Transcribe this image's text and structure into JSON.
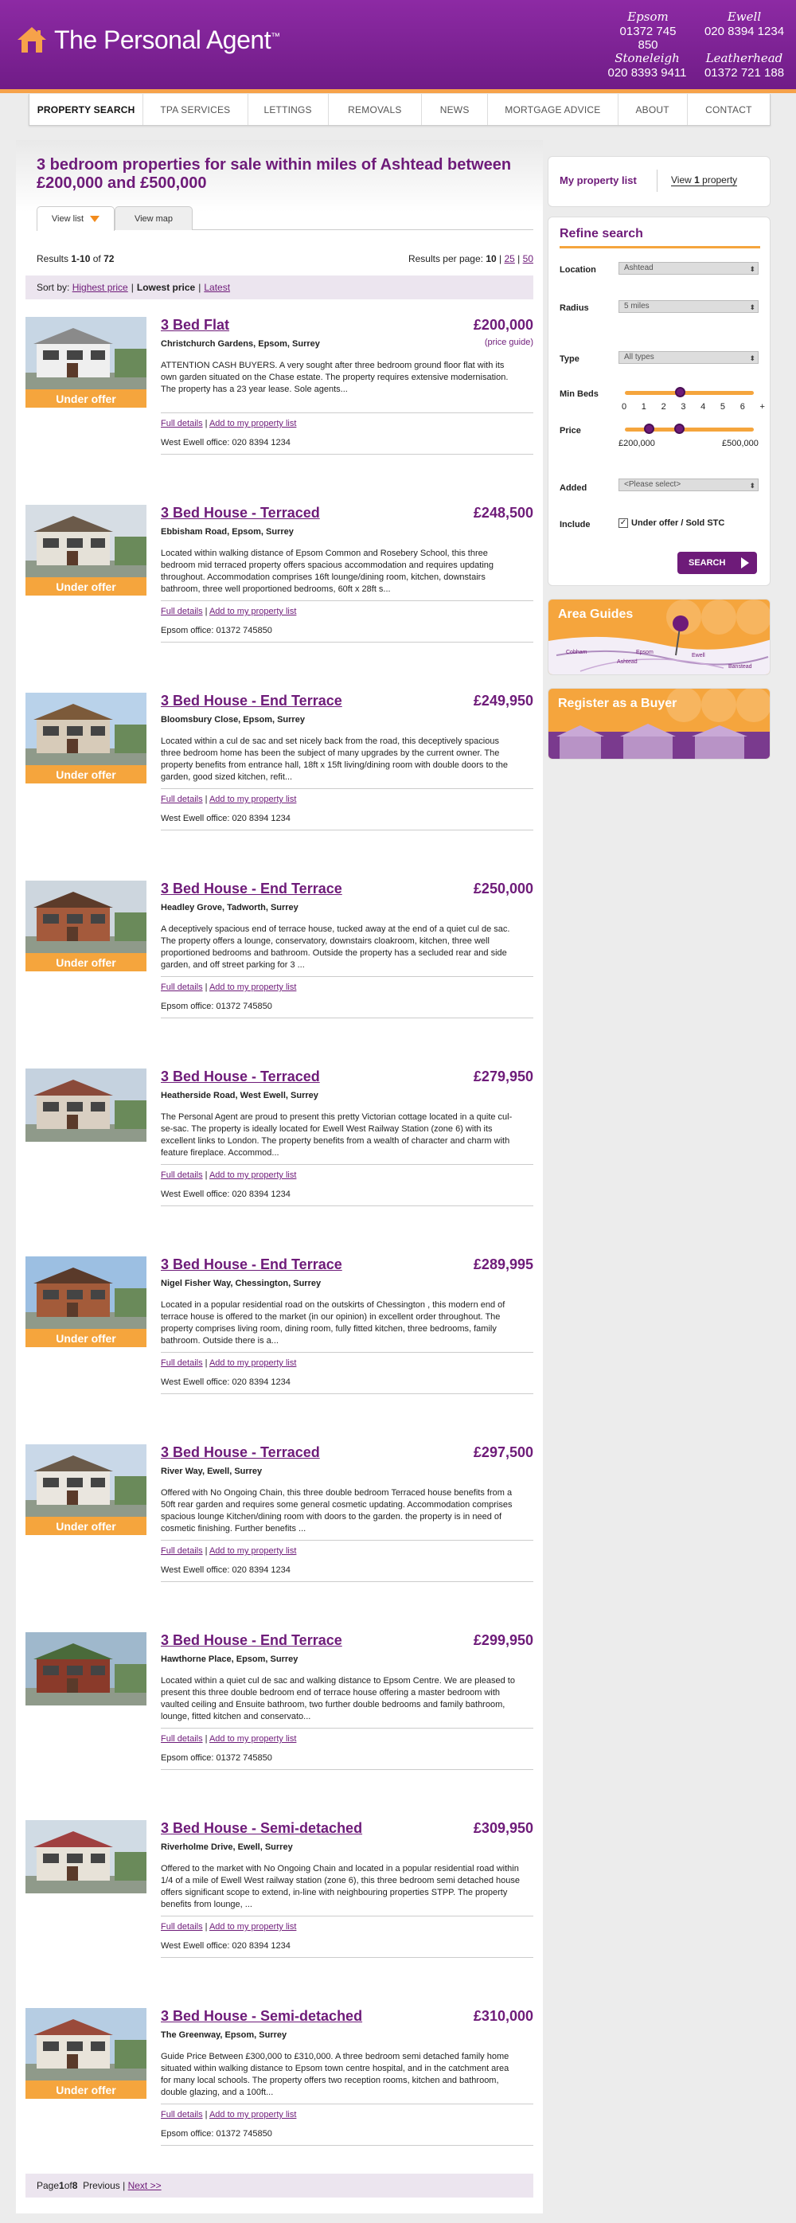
{
  "brand": {
    "name": "The Personal Agent",
    "tm": "™"
  },
  "offices": [
    {
      "name": "Epsom",
      "phone": "01372 745 850"
    },
    {
      "name": "Ewell",
      "phone": "020 8394 1234"
    },
    {
      "name": "Stoneleigh",
      "phone": "020 8393 9411"
    },
    {
      "name": "Leatherhead",
      "phone": "01372 721 188"
    }
  ],
  "nav": [
    {
      "label": "PROPERTY SEARCH",
      "active": true
    },
    {
      "label": "TPA SERVICES"
    },
    {
      "label": "LETTINGS"
    },
    {
      "label": "REMOVALS"
    },
    {
      "label": "NEWS"
    },
    {
      "label": "MORTGAGE ADVICE"
    },
    {
      "label": "ABOUT"
    },
    {
      "label": "CONTACT"
    }
  ],
  "page_title": "3 bedroom properties for sale within miles of Ashtead between £200,000 and £500,000",
  "tabs": {
    "list": "View list",
    "map": "View map"
  },
  "results": {
    "prefix": "Results ",
    "range": "1-10",
    "of": " of ",
    "total": "72",
    "rpp_label": "Results per page: ",
    "rpp_current": "10",
    "rpp_25": "25",
    "rpp_50": "50"
  },
  "sort": {
    "label": "Sort by:",
    "highest": "Highest price",
    "lowest": "Lowest price",
    "latest": "Latest"
  },
  "link_labels": {
    "details": "Full details",
    "add": "Add to my property list",
    "sep": "|"
  },
  "under_offer_label": "Under offer",
  "listings": [
    {
      "title": "3 Bed Flat",
      "price": "£200,000",
      "guide": "(price guide)",
      "address": "Christchurch Gardens, Epsom, Surrey",
      "desc": "ATTENTION CASH BUYERS. A very sought after three bedroom ground floor flat with its own garden situated on the Chase estate. The property requires extensive modernisation. The property has a 23 year lease. Sole agents...",
      "office": "West Ewell office: 020 8394 1234",
      "under_offer": true
    },
    {
      "title": "3 Bed House - Terraced",
      "price": "£248,500",
      "address": "Ebbisham Road, Epsom, Surrey",
      "desc": "Located within walking distance of Epsom Common and Rosebery School, this three bedroom mid terraced property offers spacious accommodation and requires updating throughout. Accommodation comprises 16ft lounge/dining room, kitchen, downstairs bathroom, three well proportioned bedrooms, 60ft x 28ft s...",
      "office": "Epsom office: 01372 745850",
      "under_offer": true
    },
    {
      "title": "3 Bed House - End Terrace",
      "price": "£249,950",
      "address": "Bloomsbury Close, Epsom, Surrey",
      "desc": "Located within a cul de sac and set nicely back from the road, this deceptively spacious three bedroom home has been the subject of many upgrades by the current owner. The property benefits from entrance hall, 18ft x 15ft living/dining room with double doors to the garden, good sized kitchen, refit...",
      "office": "West Ewell office: 020 8394 1234",
      "under_offer": true
    },
    {
      "title": "3 Bed House - End Terrace",
      "price": "£250,000",
      "address": "Headley Grove, Tadworth, Surrey",
      "desc": "A deceptively spacious end of terrace house, tucked away at the end of a quiet cul de sac. The property offers a lounge, conservatory, downstairs cloakroom, kitchen, three well proportioned bedrooms and bathroom. Outside the property has a secluded rear and side garden, and off street parking for 3 ...",
      "office": "Epsom office: 01372 745850",
      "under_offer": true
    },
    {
      "title": "3 Bed House - Terraced",
      "price": "£279,950",
      "address": "Heatherside Road, West Ewell, Surrey",
      "desc": "The Personal Agent are proud to present this pretty Victorian cottage located in a quite cul-se-sac. The property is ideally located for Ewell West Railway Station (zone 6) with its excellent links to London. The property benefits from a wealth of character and charm with feature fireplace. Accommod...",
      "office": "West Ewell office: 020 8394 1234",
      "under_offer": false
    },
    {
      "title": "3 Bed House - End Terrace",
      "price": "£289,995",
      "address": "Nigel Fisher Way, Chessington, Surrey",
      "desc": "Located in a popular residential road on the outskirts of Chessington , this modern end of terrace house is offered to the market (in our opinion) in excellent order throughout. The property comprises living room, dining room, fully fitted kitchen, three bedrooms, family bathroom. Outside there is a...",
      "office": "West Ewell office: 020 8394 1234",
      "under_offer": true
    },
    {
      "title": "3 Bed House - Terraced",
      "price": "£297,500",
      "address": "River Way, Ewell, Surrey",
      "desc": "Offered with No Ongoing Chain, this three double bedroom Terraced house benefits from a 50ft rear garden and requires some general cosmetic updating. Accommodation comprises spacious lounge Kitchen/dining room with doors to the garden. the property is in need of cosmetic finishing. Further benefits ...",
      "office": "West Ewell office: 020 8394 1234",
      "under_offer": true
    },
    {
      "title": "3 Bed House - End Terrace",
      "price": "£299,950",
      "address": "Hawthorne Place, Epsom, Surrey",
      "desc": "Located within a quiet cul de sac and walking distance to Epsom Centre. We are pleased to present this three double bedroom end of terrace house offering a master bedroom with vaulted ceiling and Ensuite bathroom, two further double bedrooms and family bathroom, lounge, fitted kitchen and conservato...",
      "office": "Epsom office: 01372 745850",
      "under_offer": false
    },
    {
      "title": "3 Bed House - Semi-detached",
      "price": "£309,950",
      "address": "Riverholme Drive, Ewell, Surrey",
      "desc": "Offered to the market with No Ongoing Chain and located in a popular residential road within 1/4 of a mile of Ewell West railway station (zone 6), this three bedroom semi detached house offers significant scope to extend, in-line with neighbouring properties STPP. The property benefits from lounge, ...",
      "office": "West Ewell office: 020 8394 1234",
      "under_offer": false
    },
    {
      "title": "3 Bed House - Semi-detached",
      "price": "£310,000",
      "address": "The Greenway, Epsom, Surrey",
      "desc": "Guide Price Between £300,000 to £310,000. A three bedroom semi detached family home situated within walking distance to Epsom town centre hospital, and in the catchment area for many local schools. The property offers two reception rooms, kitchen and bathroom, double glazing, and a 100ft...",
      "office": "Epsom office: 01372 745850",
      "under_offer": true
    }
  ],
  "pager": {
    "prefix": "Page ",
    "current": "1",
    "of": " of ",
    "total": "8",
    "prev": "Previous",
    "sep": "|",
    "next": "Next >>"
  },
  "my_list": {
    "title": "My property list",
    "view_prefix": "View ",
    "count": "1",
    "view_suffix": " property"
  },
  "refine": {
    "title": "Refine search",
    "location_label": "Location",
    "location_value": "Ashtead",
    "radius_label": "Radius",
    "radius_value": "5 miles",
    "type_label": "Type",
    "type_value": "All types",
    "minbeds_label": "Min Beds",
    "minbeds_ticks": [
      "0",
      "1",
      "2",
      "3",
      "4",
      "5",
      "6",
      "+"
    ],
    "minbeds_value": 3,
    "price_label": "Price",
    "price_min": "£200,000",
    "price_max": "£500,000",
    "added_label": "Added",
    "added_value": "<Please select>",
    "include_label": "Include",
    "include_option": "Under offer / Sold STC",
    "include_checked": "✓",
    "search_label": "SEARCH"
  },
  "promos": {
    "area_guides": "Area Guides",
    "register": "Register as a Buyer",
    "map_labels": [
      "Epsom",
      "Ashtead",
      "Ewell",
      "Cobham",
      "Banstead"
    ]
  },
  "colors": {
    "brand_purple": "#6e1b79",
    "accent_orange": "#f5a53d"
  }
}
